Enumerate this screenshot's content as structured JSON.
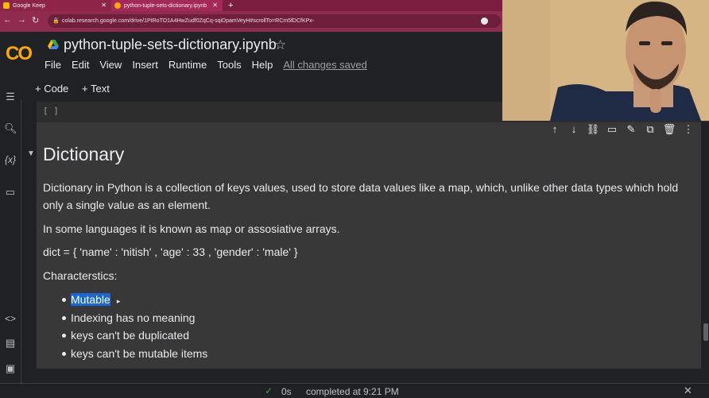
{
  "browser": {
    "tabs": [
      {
        "title": "Google Keep",
        "color": "#fbbc04"
      },
      {
        "title": "python-tuple-sets-dictionary.ipynb",
        "color": "#f9ab00"
      }
    ],
    "url": "colab.research.google.com/drive/1PtRoTO1A4HwZudf0ZqCq-sqiDpamVeyH#scrollTo=RCm5fDCfKPx-"
  },
  "colab": {
    "logo": "CO",
    "title": "python-tuple-sets-dictionary.ipynb",
    "menu": [
      "File",
      "Edit",
      "View",
      "Insert",
      "Runtime",
      "Tools",
      "Help"
    ],
    "saved_status": "All changes saved",
    "toolbar": {
      "code_label": "+ Code",
      "text_label": "+ Text"
    }
  },
  "code_cell": {
    "prompt": "[ ]"
  },
  "text_cell": {
    "heading": "Dictionary",
    "paragraphs": [
      "Dictionary in Python is a collection of keys values, used to store data values like a map, which, unlike other data types which hold only a single value as an element.",
      "In some languages it is known as map or assosiative arrays.",
      "dict = { 'name' : 'nitish' , 'age' : 33 , 'gender' : 'male' }",
      "Characterstics:"
    ],
    "bullets": [
      "Mutable",
      "Indexing has no meaning",
      "keys can't be duplicated",
      "keys can't be mutable items"
    ]
  },
  "status_bar": {
    "duration": "0s",
    "message": "completed at 9:21 PM"
  }
}
